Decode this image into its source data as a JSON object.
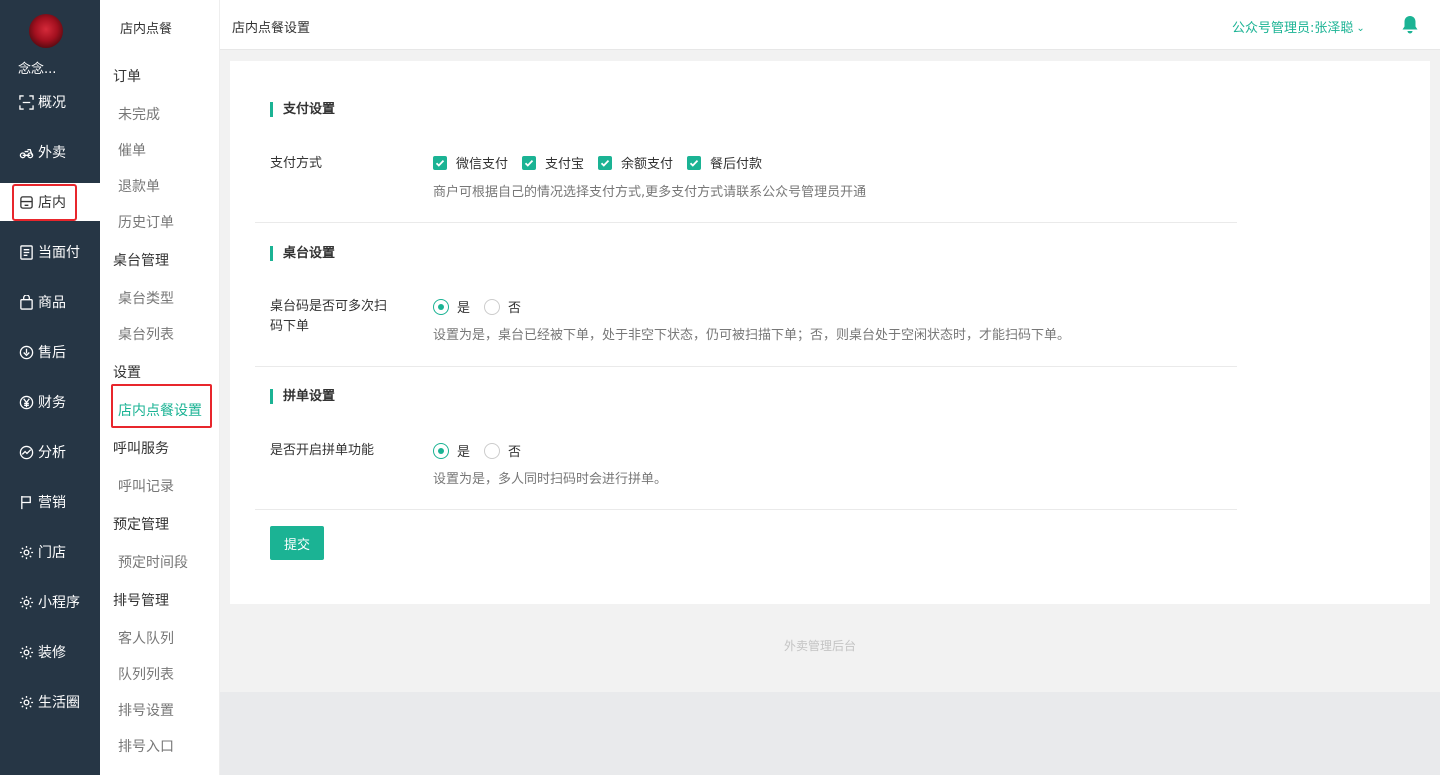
{
  "nav": {
    "shop_name": "念念...",
    "items": [
      {
        "label": "概况",
        "icon": "overview-icon"
      },
      {
        "label": "外卖",
        "icon": "takeout-icon"
      },
      {
        "label": "店内",
        "icon": "store-icon"
      },
      {
        "label": "当面付",
        "icon": "face-pay-icon"
      },
      {
        "label": "商品",
        "icon": "bag-icon"
      },
      {
        "label": "售后",
        "icon": "after-sale-icon"
      },
      {
        "label": "财务",
        "icon": "yen-icon"
      },
      {
        "label": "分析",
        "icon": "analytics-icon"
      },
      {
        "label": "营销",
        "icon": "flag-icon"
      },
      {
        "label": "门店",
        "icon": "gear-icon"
      },
      {
        "label": "小程序",
        "icon": "gear-icon"
      },
      {
        "label": "装修",
        "icon": "gear-icon"
      },
      {
        "label": "生活圈",
        "icon": "gear-icon"
      }
    ],
    "active": "店内"
  },
  "submenu": {
    "title": "店内点餐",
    "groups": [
      {
        "label": "订单",
        "links": [
          "未完成",
          "催单",
          "退款单",
          "历史订单"
        ]
      },
      {
        "label": "桌台管理",
        "links": [
          "桌台类型",
          "桌台列表"
        ]
      },
      {
        "label": "设置",
        "links": [
          "店内点餐设置"
        ]
      },
      {
        "label": "呼叫服务",
        "links": [
          "呼叫记录"
        ]
      },
      {
        "label": "预定管理",
        "links": [
          "预定时间段"
        ]
      },
      {
        "label": "排号管理",
        "links": [
          "客人队列",
          "队列列表",
          "排号设置",
          "排号入口"
        ]
      }
    ],
    "active": "店内点餐设置"
  },
  "header": {
    "breadcrumb": "店内点餐设置",
    "admin": "公众号管理员:张泽聪"
  },
  "payment": {
    "title": "支付设置",
    "label": "支付方式",
    "options": [
      {
        "label": "微信支付",
        "checked": true
      },
      {
        "label": "支付宝",
        "checked": true
      },
      {
        "label": "余额支付",
        "checked": true
      },
      {
        "label": "餐后付款",
        "checked": true
      }
    ],
    "help": "商户可根据自己的情况选择支付方式,更多支付方式请联系公众号管理员开通"
  },
  "table": {
    "title": "桌台设置",
    "label_line1": "桌台码是否可多次扫",
    "label_line2": "码下单",
    "yes": "是",
    "no": "否",
    "selected": "是",
    "help": "设置为是，桌台已经被下单，处于非空下状态，仍可被扫描下单；否，则桌台处于空闲状态时，才能扫码下单。"
  },
  "group_order": {
    "title": "拼单设置",
    "label": "是否开启拼单功能",
    "yes": "是",
    "no": "否",
    "selected": "是",
    "help": "设置为是，多人同时扫码时会进行拼单。"
  },
  "submit_label": "提交",
  "footer": "外卖管理后台",
  "colors": {
    "accent": "#1bb394",
    "nav_bg": "#263645",
    "highlight": "#e8262c"
  }
}
